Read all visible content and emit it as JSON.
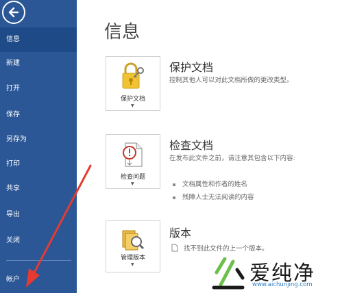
{
  "sidebar": {
    "back_icon": "back-arrow-icon",
    "items": [
      {
        "label": "信息",
        "active": true
      },
      {
        "label": "新建"
      },
      {
        "label": "打开"
      },
      {
        "label": "保存"
      },
      {
        "label": "另存为"
      },
      {
        "label": "打印"
      },
      {
        "label": "共享"
      },
      {
        "label": "导出"
      },
      {
        "label": "关闭"
      },
      {
        "label": "帐户"
      }
    ]
  },
  "page": {
    "title": "信息"
  },
  "sections": {
    "protect": {
      "button_label": "保护文档",
      "title": "保护文档",
      "description": "控制其他人可以对此文档所做的更改类型。",
      "icon": "lock-key-icon"
    },
    "inspect": {
      "button_label": "检查问题",
      "title": "检查文档",
      "description": "在发布此文件之前，请注意其包含以下内容:",
      "bullets": [
        "文档属性和作者的姓名",
        "残障人士无法阅读的内容"
      ],
      "icon": "inspect-document-icon"
    },
    "versions": {
      "button_label": "管理版本",
      "title": "版本",
      "note": "找不到此文件的上一个版本。",
      "icon": "manage-versions-icon"
    }
  },
  "watermark": {
    "text": "爱纯净",
    "url": "www.aichunjing.com"
  },
  "colors": {
    "sidebar": "#2b5797",
    "sidebar_active": "#1e4a87",
    "annotation_arrow": "#e53a30",
    "watermark_green": "#6cc04a"
  }
}
